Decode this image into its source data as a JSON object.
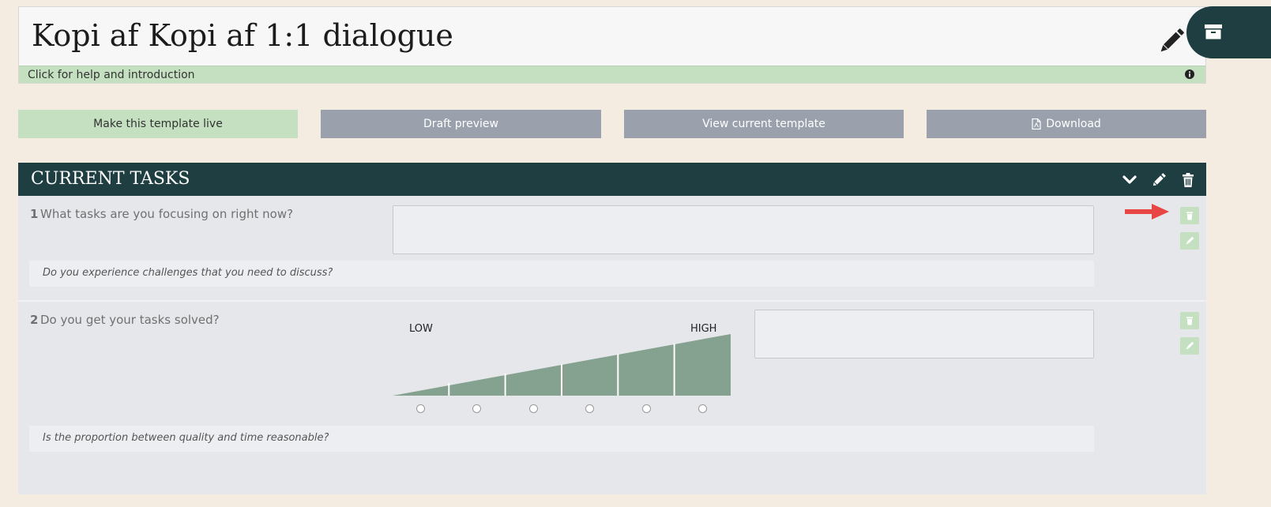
{
  "header": {
    "title": "Kopi af Kopi af 1:1 dialogue",
    "help_text": "Click for help and introduction"
  },
  "actions": {
    "make_live": "Make this template live",
    "draft_preview": "Draft preview",
    "view_current": "View current template",
    "download": "Download"
  },
  "section": {
    "title": "CURRENT TASKS",
    "questions": [
      {
        "number": "1",
        "text": "What tasks are you focusing on right now?",
        "hint": "Do you experience challenges that you need to discuss?"
      },
      {
        "number": "2",
        "text": "Do you get your tasks solved?",
        "hint": "Is the proportion between quality and time reasonable?",
        "scale_low": "LOW",
        "scale_high": "HIGH",
        "scale_steps": 6
      }
    ]
  },
  "colors": {
    "accent_dark": "#1e3e42",
    "accent_green": "#c4e0c0",
    "button_grey": "#9aa1ac",
    "scale_fill": "#84a28f",
    "annotation_arrow": "#e84545"
  },
  "icons": [
    "pencil-icon",
    "info-icon",
    "archive-icon",
    "pdf-icon",
    "chevron-down-icon",
    "trash-icon",
    "arrow-icon"
  ]
}
